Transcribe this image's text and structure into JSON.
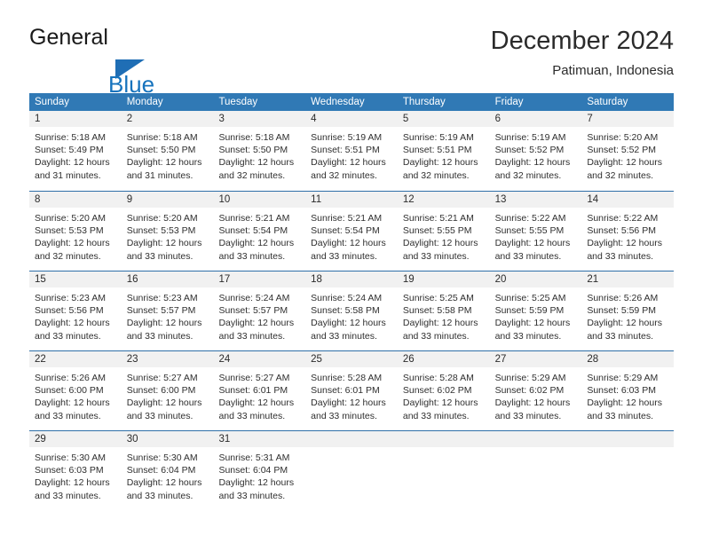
{
  "brand": {
    "name_part1": "General",
    "name_part2": "Blue",
    "triangle_icon": "triangle-logo-icon",
    "accent_color": "#1673bd"
  },
  "header": {
    "title": "December 2024",
    "subtitle": "Patimuan, Indonesia"
  },
  "calendar": {
    "header_bg": "#3079b5",
    "daynum_bg": "#f1f1f1",
    "row_border": "#2f6fa8",
    "weekdays": [
      "Sunday",
      "Monday",
      "Tuesday",
      "Wednesday",
      "Thursday",
      "Friday",
      "Saturday"
    ],
    "weeks": [
      [
        {
          "day": "1",
          "sunrise": "Sunrise: 5:18 AM",
          "sunset": "Sunset: 5:49 PM",
          "daylight1": "Daylight: 12 hours",
          "daylight2": "and 31 minutes."
        },
        {
          "day": "2",
          "sunrise": "Sunrise: 5:18 AM",
          "sunset": "Sunset: 5:50 PM",
          "daylight1": "Daylight: 12 hours",
          "daylight2": "and 31 minutes."
        },
        {
          "day": "3",
          "sunrise": "Sunrise: 5:18 AM",
          "sunset": "Sunset: 5:50 PM",
          "daylight1": "Daylight: 12 hours",
          "daylight2": "and 32 minutes."
        },
        {
          "day": "4",
          "sunrise": "Sunrise: 5:19 AM",
          "sunset": "Sunset: 5:51 PM",
          "daylight1": "Daylight: 12 hours",
          "daylight2": "and 32 minutes."
        },
        {
          "day": "5",
          "sunrise": "Sunrise: 5:19 AM",
          "sunset": "Sunset: 5:51 PM",
          "daylight1": "Daylight: 12 hours",
          "daylight2": "and 32 minutes."
        },
        {
          "day": "6",
          "sunrise": "Sunrise: 5:19 AM",
          "sunset": "Sunset: 5:52 PM",
          "daylight1": "Daylight: 12 hours",
          "daylight2": "and 32 minutes."
        },
        {
          "day": "7",
          "sunrise": "Sunrise: 5:20 AM",
          "sunset": "Sunset: 5:52 PM",
          "daylight1": "Daylight: 12 hours",
          "daylight2": "and 32 minutes."
        }
      ],
      [
        {
          "day": "8",
          "sunrise": "Sunrise: 5:20 AM",
          "sunset": "Sunset: 5:53 PM",
          "daylight1": "Daylight: 12 hours",
          "daylight2": "and 32 minutes."
        },
        {
          "day": "9",
          "sunrise": "Sunrise: 5:20 AM",
          "sunset": "Sunset: 5:53 PM",
          "daylight1": "Daylight: 12 hours",
          "daylight2": "and 33 minutes."
        },
        {
          "day": "10",
          "sunrise": "Sunrise: 5:21 AM",
          "sunset": "Sunset: 5:54 PM",
          "daylight1": "Daylight: 12 hours",
          "daylight2": "and 33 minutes."
        },
        {
          "day": "11",
          "sunrise": "Sunrise: 5:21 AM",
          "sunset": "Sunset: 5:54 PM",
          "daylight1": "Daylight: 12 hours",
          "daylight2": "and 33 minutes."
        },
        {
          "day": "12",
          "sunrise": "Sunrise: 5:21 AM",
          "sunset": "Sunset: 5:55 PM",
          "daylight1": "Daylight: 12 hours",
          "daylight2": "and 33 minutes."
        },
        {
          "day": "13",
          "sunrise": "Sunrise: 5:22 AM",
          "sunset": "Sunset: 5:55 PM",
          "daylight1": "Daylight: 12 hours",
          "daylight2": "and 33 minutes."
        },
        {
          "day": "14",
          "sunrise": "Sunrise: 5:22 AM",
          "sunset": "Sunset: 5:56 PM",
          "daylight1": "Daylight: 12 hours",
          "daylight2": "and 33 minutes."
        }
      ],
      [
        {
          "day": "15",
          "sunrise": "Sunrise: 5:23 AM",
          "sunset": "Sunset: 5:56 PM",
          "daylight1": "Daylight: 12 hours",
          "daylight2": "and 33 minutes."
        },
        {
          "day": "16",
          "sunrise": "Sunrise: 5:23 AM",
          "sunset": "Sunset: 5:57 PM",
          "daylight1": "Daylight: 12 hours",
          "daylight2": "and 33 minutes."
        },
        {
          "day": "17",
          "sunrise": "Sunrise: 5:24 AM",
          "sunset": "Sunset: 5:57 PM",
          "daylight1": "Daylight: 12 hours",
          "daylight2": "and 33 minutes."
        },
        {
          "day": "18",
          "sunrise": "Sunrise: 5:24 AM",
          "sunset": "Sunset: 5:58 PM",
          "daylight1": "Daylight: 12 hours",
          "daylight2": "and 33 minutes."
        },
        {
          "day": "19",
          "sunrise": "Sunrise: 5:25 AM",
          "sunset": "Sunset: 5:58 PM",
          "daylight1": "Daylight: 12 hours",
          "daylight2": "and 33 minutes."
        },
        {
          "day": "20",
          "sunrise": "Sunrise: 5:25 AM",
          "sunset": "Sunset: 5:59 PM",
          "daylight1": "Daylight: 12 hours",
          "daylight2": "and 33 minutes."
        },
        {
          "day": "21",
          "sunrise": "Sunrise: 5:26 AM",
          "sunset": "Sunset: 5:59 PM",
          "daylight1": "Daylight: 12 hours",
          "daylight2": "and 33 minutes."
        }
      ],
      [
        {
          "day": "22",
          "sunrise": "Sunrise: 5:26 AM",
          "sunset": "Sunset: 6:00 PM",
          "daylight1": "Daylight: 12 hours",
          "daylight2": "and 33 minutes."
        },
        {
          "day": "23",
          "sunrise": "Sunrise: 5:27 AM",
          "sunset": "Sunset: 6:00 PM",
          "daylight1": "Daylight: 12 hours",
          "daylight2": "and 33 minutes."
        },
        {
          "day": "24",
          "sunrise": "Sunrise: 5:27 AM",
          "sunset": "Sunset: 6:01 PM",
          "daylight1": "Daylight: 12 hours",
          "daylight2": "and 33 minutes."
        },
        {
          "day": "25",
          "sunrise": "Sunrise: 5:28 AM",
          "sunset": "Sunset: 6:01 PM",
          "daylight1": "Daylight: 12 hours",
          "daylight2": "and 33 minutes."
        },
        {
          "day": "26",
          "sunrise": "Sunrise: 5:28 AM",
          "sunset": "Sunset: 6:02 PM",
          "daylight1": "Daylight: 12 hours",
          "daylight2": "and 33 minutes."
        },
        {
          "day": "27",
          "sunrise": "Sunrise: 5:29 AM",
          "sunset": "Sunset: 6:02 PM",
          "daylight1": "Daylight: 12 hours",
          "daylight2": "and 33 minutes."
        },
        {
          "day": "28",
          "sunrise": "Sunrise: 5:29 AM",
          "sunset": "Sunset: 6:03 PM",
          "daylight1": "Daylight: 12 hours",
          "daylight2": "and 33 minutes."
        }
      ],
      [
        {
          "day": "29",
          "sunrise": "Sunrise: 5:30 AM",
          "sunset": "Sunset: 6:03 PM",
          "daylight1": "Daylight: 12 hours",
          "daylight2": "and 33 minutes."
        },
        {
          "day": "30",
          "sunrise": "Sunrise: 5:30 AM",
          "sunset": "Sunset: 6:04 PM",
          "daylight1": "Daylight: 12 hours",
          "daylight2": "and 33 minutes."
        },
        {
          "day": "31",
          "sunrise": "Sunrise: 5:31 AM",
          "sunset": "Sunset: 6:04 PM",
          "daylight1": "Daylight: 12 hours",
          "daylight2": "and 33 minutes."
        },
        {
          "day": "",
          "sunrise": "",
          "sunset": "",
          "daylight1": "",
          "daylight2": ""
        },
        {
          "day": "",
          "sunrise": "",
          "sunset": "",
          "daylight1": "",
          "daylight2": ""
        },
        {
          "day": "",
          "sunrise": "",
          "sunset": "",
          "daylight1": "",
          "daylight2": ""
        },
        {
          "day": "",
          "sunrise": "",
          "sunset": "",
          "daylight1": "",
          "daylight2": ""
        }
      ]
    ]
  }
}
